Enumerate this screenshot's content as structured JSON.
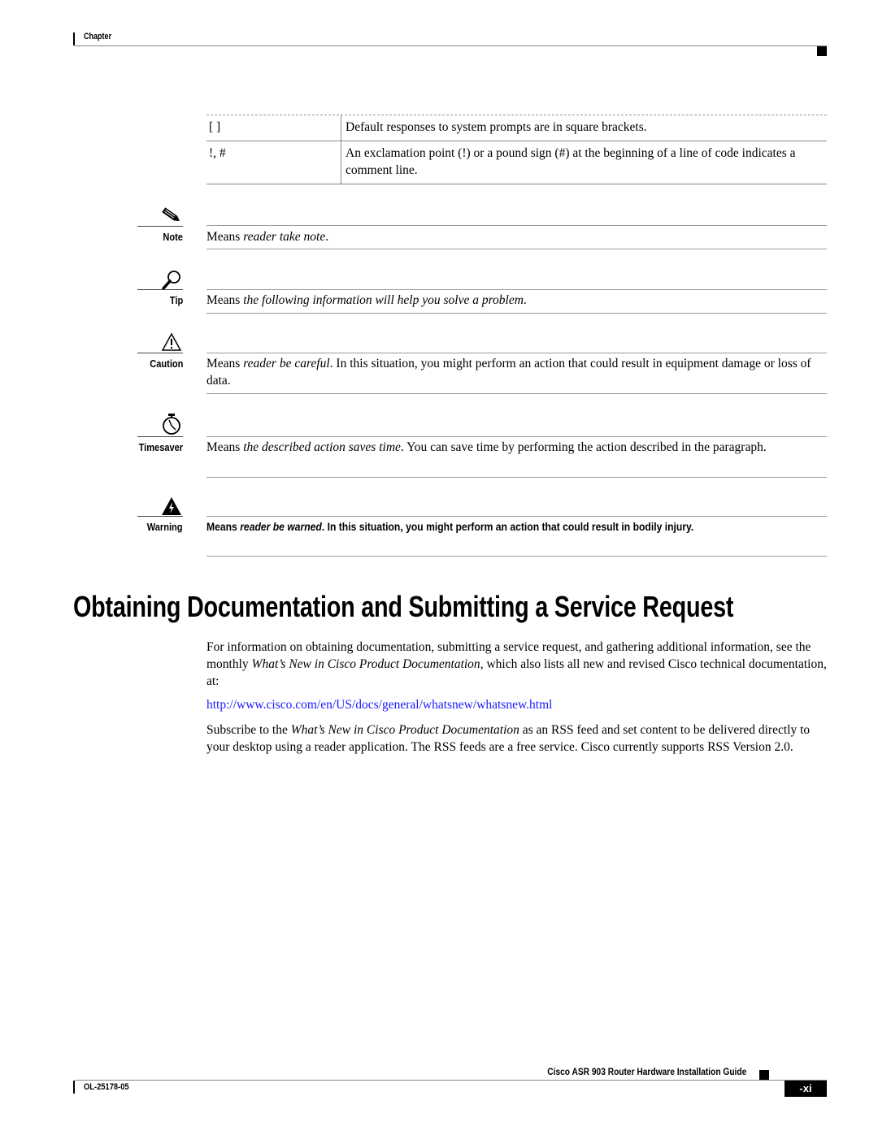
{
  "header": {
    "chapter_label": "Chapter"
  },
  "conventions_table": {
    "rows": [
      {
        "symbol": "[   ]",
        "description": "Default responses to system prompts are in square brackets."
      },
      {
        "symbol": "!, #",
        "description": "An exclamation point (!) or a pound sign (#) at the beginning of a line of code indicates a comment line."
      }
    ]
  },
  "admonitions": {
    "note": {
      "icon": "pencil-icon",
      "label": "Note",
      "prefix": "Means ",
      "emphasis": "reader take note",
      "suffix": "."
    },
    "tip": {
      "icon": "magnifier-icon",
      "label": "Tip",
      "prefix": "Means ",
      "emphasis": "the following information will help you solve a problem",
      "suffix": "."
    },
    "caution": {
      "icon": "caution-triangle-icon",
      "label": "Caution",
      "prefix": "Means ",
      "emphasis": "reader be careful",
      "suffix": ". In this situation, you might perform an action that could result in equipment damage or loss of data."
    },
    "timesaver": {
      "icon": "stopwatch-icon",
      "label": "Timesaver",
      "prefix": "Means ",
      "emphasis": "the described action saves time",
      "suffix": ". You can save time by performing the action described in the paragraph."
    },
    "warning": {
      "icon": "warning-lightning-icon",
      "label": "Warning",
      "prefix": "Means ",
      "emphasis": "reader be warned",
      "suffix": ". In this situation, you might perform an action that could result in bodily injury."
    }
  },
  "section": {
    "title": "Obtaining Documentation and Submitting a Service Request",
    "para1_a": "For information on obtaining documentation, submitting a service request, and gathering additional information, see the monthly ",
    "para1_em": "What’s New in Cisco Product Documentation",
    "para1_b": ", which also lists all new and revised Cisco technical documentation, at:",
    "link": "http://www.cisco.com/en/US/docs/general/whatsnew/whatsnew.html",
    "para2_a": "Subscribe to the ",
    "para2_em": "What’s New in Cisco Product Documentation",
    "para2_b": " as an RSS feed and set content to be delivered directly to your desktop using a reader application. The RSS feeds are a free service. Cisco currently supports RSS Version 2.0."
  },
  "footer": {
    "guide_title": "Cisco ASR 903 Router Hardware Installation Guide",
    "doc_number": "OL-25178-05",
    "page_number": "-xi"
  }
}
